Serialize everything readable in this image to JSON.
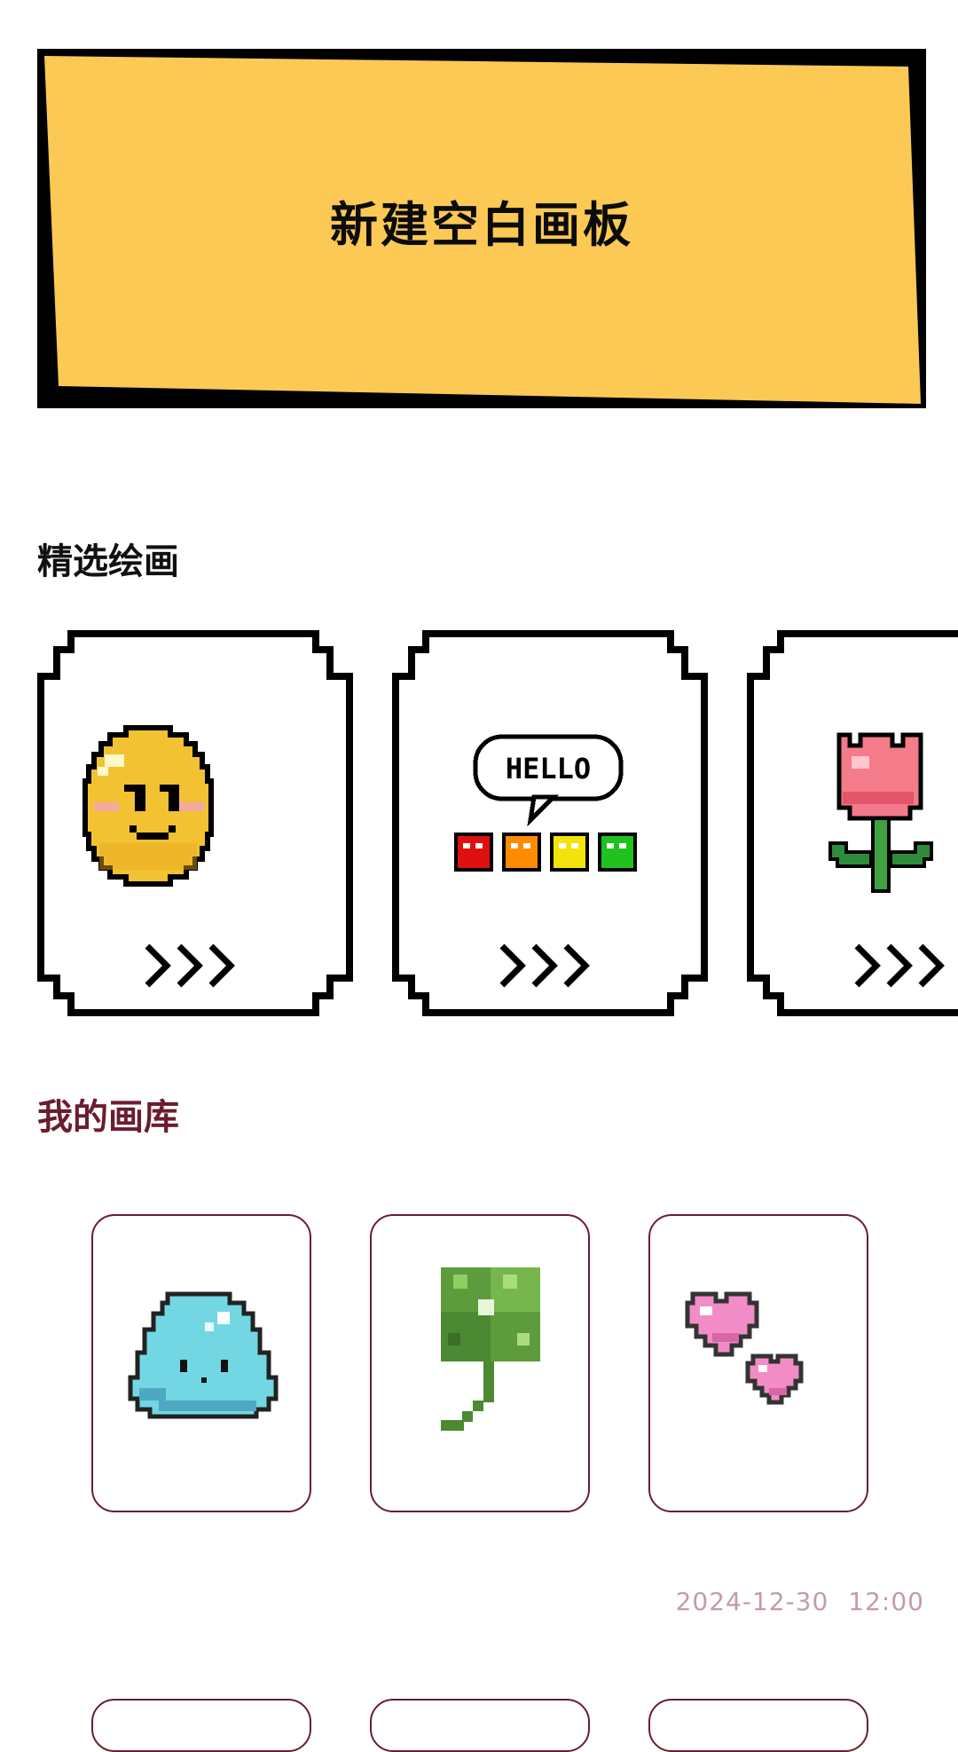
{
  "new_canvas": {
    "label": "新建空白画板"
  },
  "sections": {
    "featured_title": "精选绘画",
    "gallery_title": "我的画库"
  },
  "featured": [
    {
      "art": "smiley-face",
      "arrow_icon": "triple-chevron-right-icon"
    },
    {
      "art": "hello-speech-bubble",
      "bubble_text": "HELLO",
      "arrow_icon": "triple-chevron-right-icon"
    },
    {
      "art": "pink-tulip",
      "arrow_icon": "triple-chevron-right-icon"
    }
  ],
  "gallery": {
    "items": [
      {
        "art": "blue-slime"
      },
      {
        "art": "four-leaf-clover"
      },
      {
        "art": "two-pink-hearts"
      }
    ],
    "date": "2024-12-30",
    "time": "12:00"
  },
  "colors": {
    "banner_yellow": "#fcc955",
    "banner_border": "#000000",
    "gallery_accent": "#6b1d2e",
    "timestamp": "#c39ca6"
  }
}
